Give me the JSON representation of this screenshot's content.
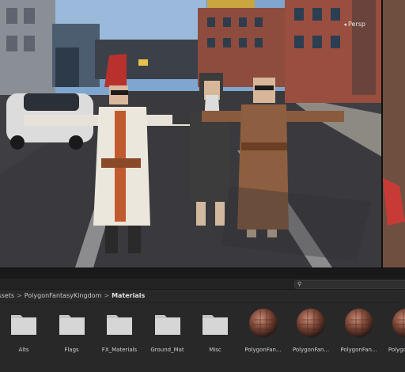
{
  "scene_view": {
    "camera_mode_label": "Persp"
  },
  "project": {
    "breadcrumb": [
      "Assets",
      "PolygonFantasyKingdom",
      "Materials"
    ],
    "breadcrumb_separator": ">",
    "assets": [
      {
        "name": "Alts",
        "kind": "folder"
      },
      {
        "name": "Flags",
        "kind": "folder"
      },
      {
        "name": "FX_Materials",
        "kind": "folder"
      },
      {
        "name": "Ground_Mat",
        "kind": "folder"
      },
      {
        "name": "Misc",
        "kind": "folder"
      },
      {
        "name": "PolygonFan...",
        "kind": "material"
      },
      {
        "name": "PolygonFan...",
        "kind": "material"
      },
      {
        "name": "PolygonFan...",
        "kind": "material"
      },
      {
        "name": "PolygonFan...",
        "kind": "material"
      }
    ]
  },
  "colors": {
    "panel_bg": "#282828",
    "folder": "#c4c4c4",
    "sky": "#7fa6cf"
  }
}
